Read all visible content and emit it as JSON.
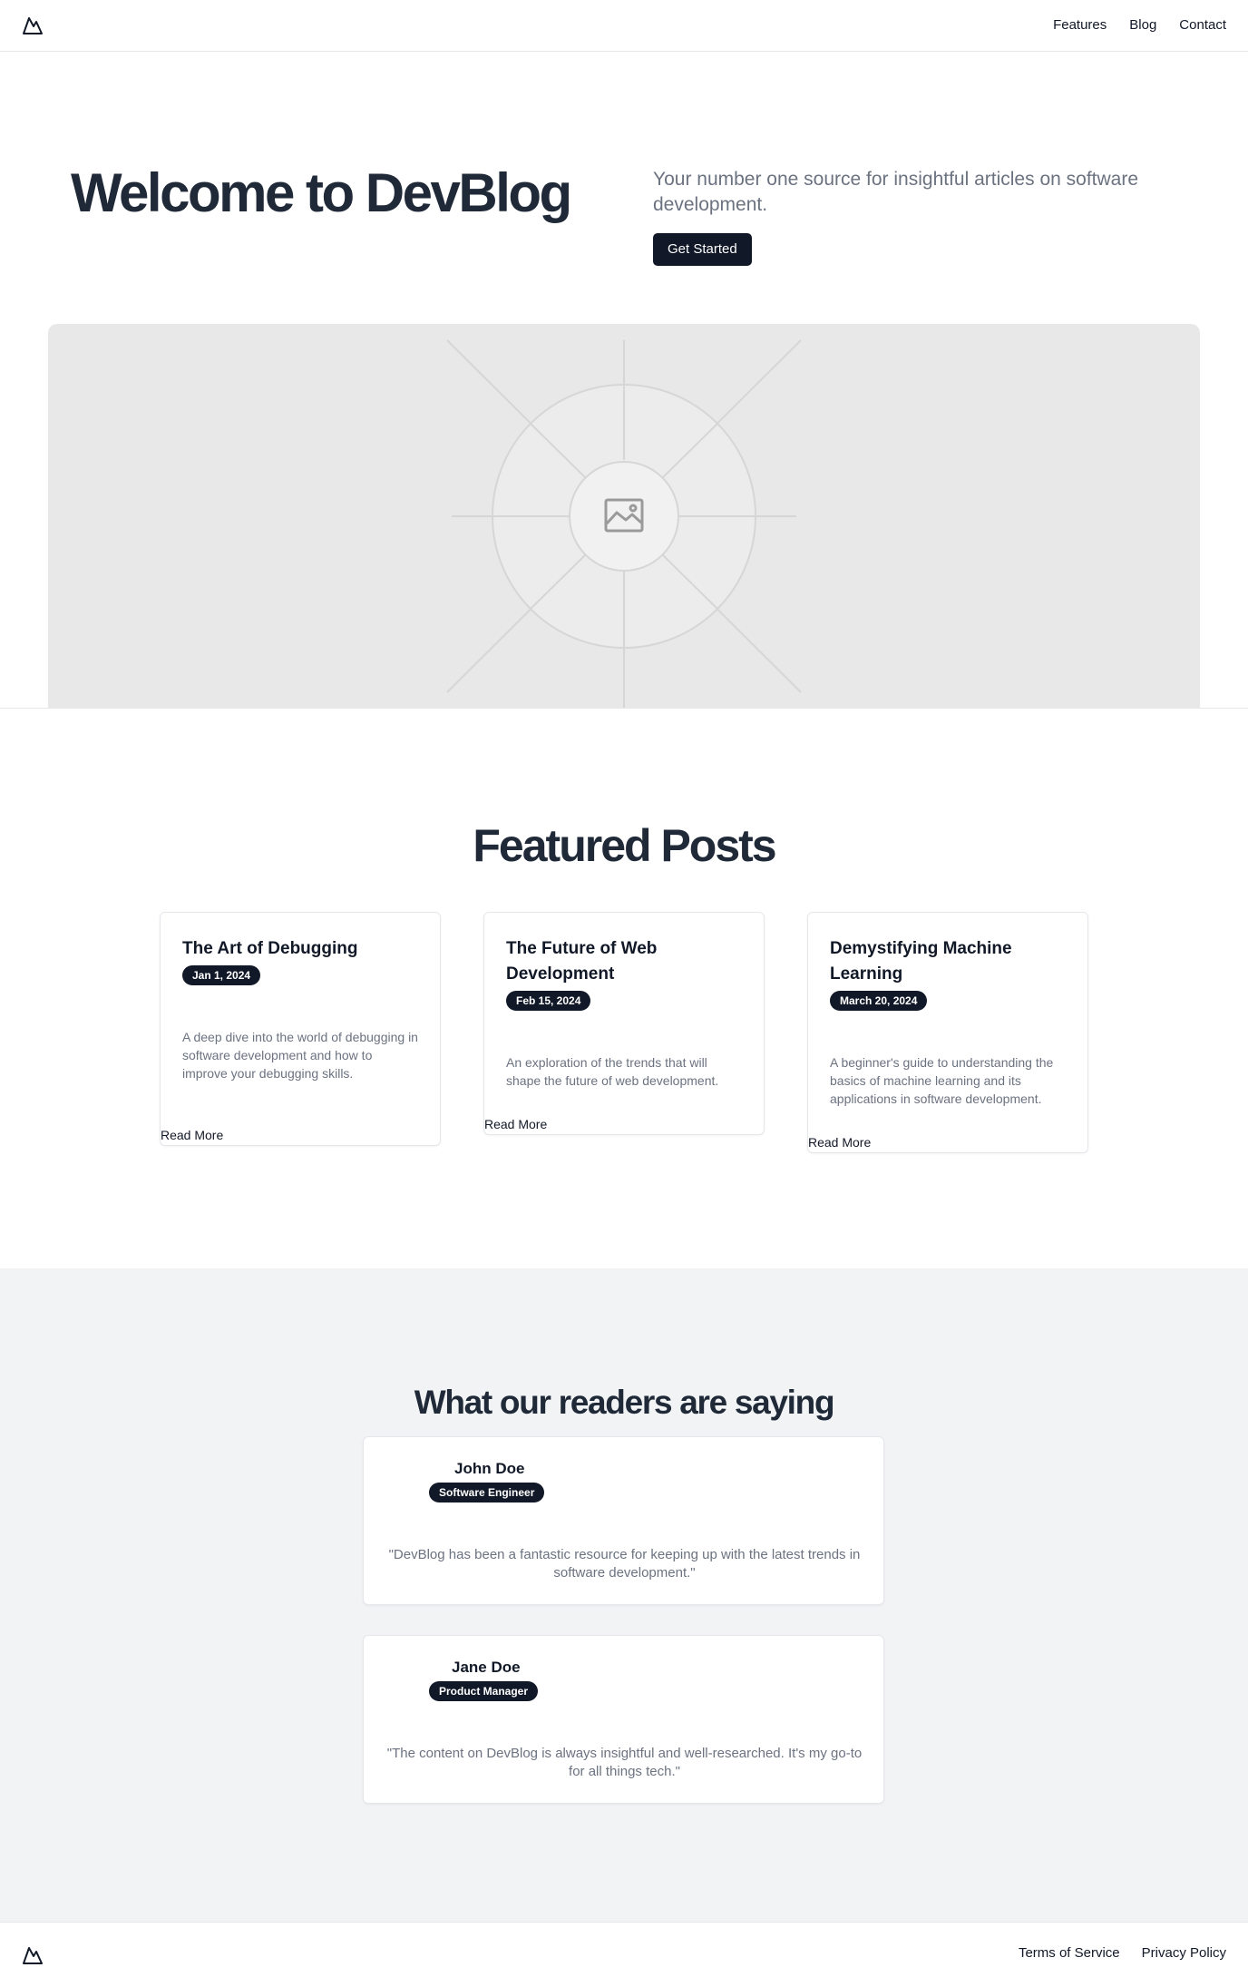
{
  "header": {
    "logo_icon": "mountain-icon",
    "nav": [
      {
        "label": "Features"
      },
      {
        "label": "Blog"
      },
      {
        "label": "Contact"
      }
    ]
  },
  "hero": {
    "title": "Welcome to DevBlog",
    "subtitle": "Your number one source for insightful articles on software development.",
    "cta_label": "Get Started",
    "image_icon": "image-placeholder-icon"
  },
  "featured": {
    "title": "Featured Posts",
    "posts": [
      {
        "title": "The Art of Debugging",
        "date": "Jan 1, 2024",
        "description": "A deep dive into the world of debugging in software development and how to improve your debugging skills.",
        "link_label": "Read More"
      },
      {
        "title": "The Future of Web Development",
        "date": "Feb 15, 2024",
        "description": "An exploration of the trends that will shape the future of web development.",
        "link_label": "Read More"
      },
      {
        "title": "Demystifying Machine Learning",
        "date": "March 20, 2024",
        "description": "A beginner's guide to understanding the basics of machine learning and its applications in software development.",
        "link_label": "Read More"
      }
    ]
  },
  "testimonials": {
    "title": "What our readers are saying",
    "items": [
      {
        "name": "John Doe",
        "role": "Software Engineer",
        "quote": "\"DevBlog has been a fantastic resource for keeping up with the latest trends in software development.\""
      },
      {
        "name": "Jane Doe",
        "role": "Product Manager",
        "quote": "\"The content on DevBlog is always insightful and well-researched. It's my go-to for all things tech.\""
      }
    ]
  },
  "footer": {
    "logo_icon": "mountain-icon",
    "links": [
      {
        "label": "Terms of Service"
      },
      {
        "label": "Privacy Policy"
      }
    ]
  },
  "colors": {
    "primary": "#111827",
    "heading": "#1f2937",
    "muted": "#6b7280",
    "section_bg": "#f2f3f5",
    "placeholder_bg": "#e8e8e8"
  }
}
